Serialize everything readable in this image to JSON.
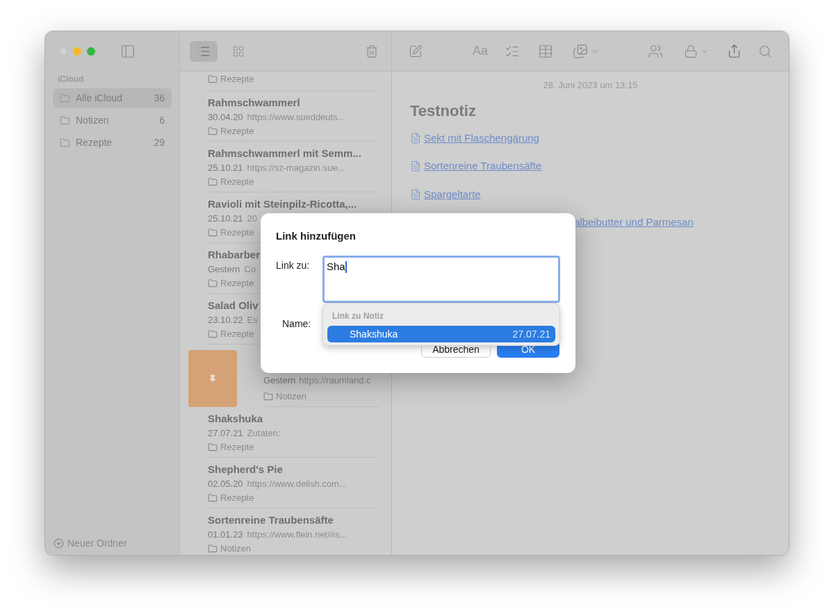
{
  "sidebar": {
    "section": "iCloud",
    "folders": [
      {
        "name": "Alle iCloud",
        "count": "36",
        "selected": true
      },
      {
        "name": "Notizen",
        "count": "6",
        "selected": false
      },
      {
        "name": "Rezepte",
        "count": "29",
        "selected": false
      }
    ],
    "new_folder": "Neuer Ordner"
  },
  "toolbar": {
    "view_buttons": [
      {
        "selected": true
      },
      {
        "selected": false
      }
    ],
    "format_label": "Aa"
  },
  "notes_list": [
    {
      "kind": "partial",
      "folder": "Rezepte"
    },
    {
      "kind": "note",
      "title": "Rahmschwammerl",
      "date": "30.04.20",
      "snippet": "https://www.sueddeuts...",
      "folder": "Rezepte"
    },
    {
      "kind": "note",
      "title": "Rahmschwammerl mit Semm...",
      "date": "25.10.21",
      "snippet": "https://sz-magazin.sue...",
      "folder": "Rezepte"
    },
    {
      "kind": "note",
      "title": "Ravioli mit Steinpilz-Ricotta,...",
      "date": "25.10.21",
      "snippet": "20",
      "folder": "Rezepte"
    },
    {
      "kind": "note",
      "title": "Rhabarber",
      "date": "Gestern",
      "snippet": "Co",
      "folder": "Rezepte"
    },
    {
      "kind": "note",
      "title": "Salad Oliv",
      "date": "23.10.22",
      "snippet": "Es",
      "folder": "Rezepte"
    },
    {
      "kind": "thumbnail",
      "date": "Gestern",
      "snippet": "https://raumland.c",
      "folder": "Notizen"
    },
    {
      "kind": "note",
      "title": "Shakshuka",
      "date": "27.07.21",
      "snippet": "Zutaten:",
      "folder": "Rezepte"
    },
    {
      "kind": "note",
      "title": "Shepherd's Pie",
      "date": "02.05.20",
      "snippet": "https://www.delish.com...",
      "folder": "Rezepte"
    },
    {
      "kind": "note",
      "title": "Sortenreine Traubensäfte",
      "date": "01.01.23",
      "snippet": "https://www.flein.net/#s...",
      "folder": "Notizen"
    }
  ],
  "note": {
    "date": "28. Juni 2023 um 13:15",
    "title": "Testnotiz",
    "links": [
      {
        "text": "Sekt mit Flaschengärung",
        "kind": "link"
      },
      {
        "text": "Sortenreine Traubensäfte",
        "kind": "link"
      },
      {
        "text": "Spargeltarte",
        "kind": "link"
      },
      {
        "text": "albeibutter und Parmesan",
        "kind": "partial"
      }
    ]
  },
  "dialog": {
    "title": "Link hinzufügen",
    "link_label": "Link zu:",
    "link_value": "Sha",
    "name_label": "Name:",
    "suggestions": {
      "header": "Link zu Notiz",
      "items": [
        {
          "title": "Shakshuka",
          "date": "27.07.21",
          "selected": true
        }
      ]
    },
    "buttons": [
      {
        "label": "Abbrechen",
        "kind": "secondary"
      },
      {
        "label": "OK",
        "kind": "primary"
      }
    ]
  }
}
